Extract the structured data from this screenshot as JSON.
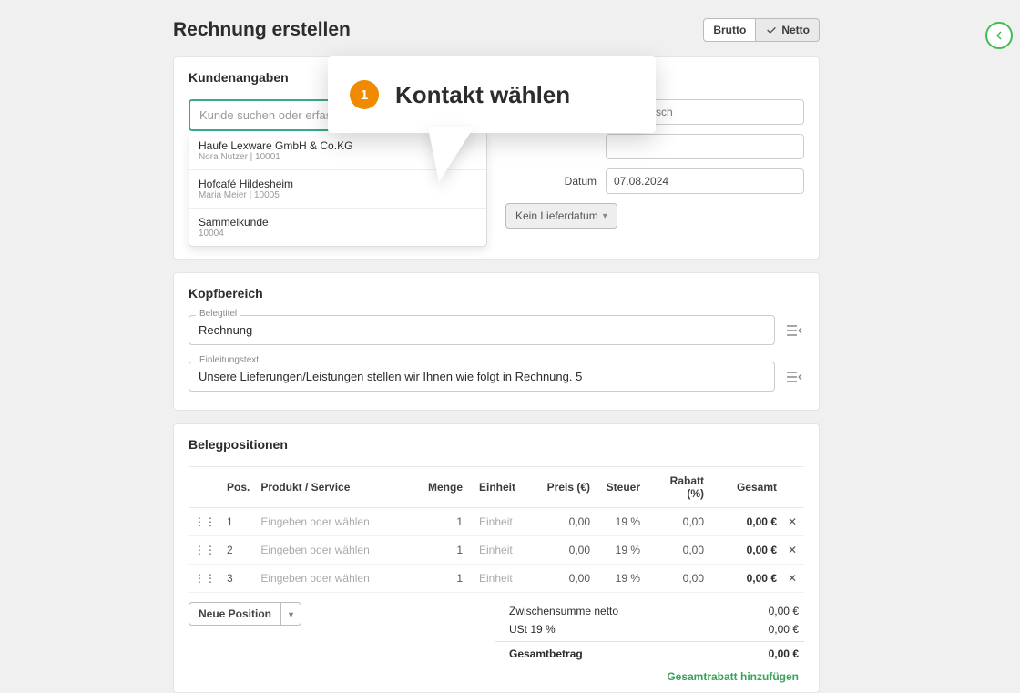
{
  "page_title": "Rechnung erstellen",
  "toggle": {
    "brutto": "Brutto",
    "netto": "Netto"
  },
  "customer": {
    "section_title": "Kundenangaben",
    "search_placeholder": "Kunde suchen oder erfassen",
    "dropdown": [
      {
        "name": "Haufe Lexware GmbH & Co.KG",
        "sub": "Nora Nutzer | 10001"
      },
      {
        "name": "Hofcafé Hildesheim",
        "sub": "Maria Meier | 10005"
      },
      {
        "name": "Sammelkunde",
        "sub": "10004"
      }
    ],
    "right": {
      "placeholder1": "automatisch",
      "date_label": "Datum",
      "date_value": "07.08.2024",
      "no_delivery": "Kein Lieferdatum"
    }
  },
  "head": {
    "section_title": "Kopfbereich",
    "title_label": "Belegtitel",
    "title_value": "Rechnung",
    "intro_label": "Einleitungstext",
    "intro_value": "Unsere Lieferungen/Leistungen stellen wir Ihnen wie folgt in Rechnung. 5"
  },
  "positions": {
    "section_title": "Belegpositionen",
    "headers": {
      "pos": "Pos.",
      "product": "Produkt / Service",
      "qty": "Menge",
      "unit": "Einheit",
      "price": "Preis (€)",
      "tax": "Steuer",
      "discount": "Rabatt (%)",
      "total": "Gesamt"
    },
    "rows": [
      {
        "pos": "1",
        "product_ph": "Eingeben oder wählen",
        "qty": "1",
        "unit": "Einheit",
        "price": "0,00",
        "tax": "19 %",
        "discount": "0,00",
        "total": "0,00 €"
      },
      {
        "pos": "2",
        "product_ph": "Eingeben oder wählen",
        "qty": "1",
        "unit": "Einheit",
        "price": "0,00",
        "tax": "19 %",
        "discount": "0,00",
        "total": "0,00 €"
      },
      {
        "pos": "3",
        "product_ph": "Eingeben oder wählen",
        "qty": "1",
        "unit": "Einheit",
        "price": "0,00",
        "tax": "19 %",
        "discount": "0,00",
        "total": "0,00 €"
      }
    ],
    "new_position": "Neue Position",
    "totals": {
      "subtotal_label": "Zwischensumme netto",
      "subtotal_value": "0,00 €",
      "vat_label": "USt 19 %",
      "vat_value": "0,00 €",
      "total_label": "Gesamtbetrag",
      "total_value": "0,00 €"
    },
    "add_discount": "Gesamtrabatt hinzufügen"
  },
  "callout": {
    "step": "1",
    "text": "Kontakt wählen"
  }
}
